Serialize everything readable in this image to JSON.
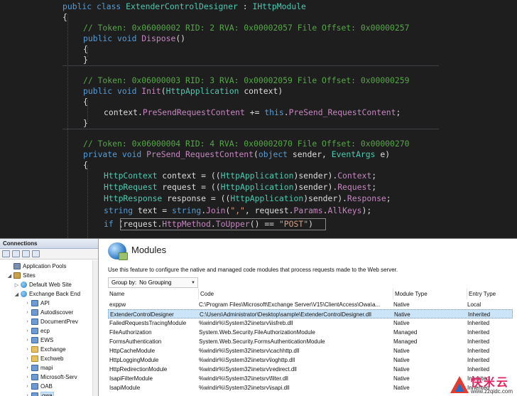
{
  "editor": {
    "class_decl": {
      "kw": "public class",
      "name": "ExtenderControlDesigner",
      "colon": ":",
      "iface": "IHttpModule"
    },
    "brace_open": "{",
    "brace_close": "}",
    "m1": {
      "comment": "// Token: 0x06000002 RID: 2 RVA: 0x00002057 File Offset: 0x00000257",
      "kw": "public void",
      "name": "Dispose",
      "args": "()"
    },
    "m2": {
      "comment": "// Token: 0x06000003 RID: 3 RVA: 0x00002059 File Offset: 0x00000259",
      "kw": "public void",
      "name": "Init",
      "args_open": "(",
      "ptype": "HttpApplication",
      "pname": " context)",
      "body": {
        "obj": "context",
        "dot": ".",
        "evt": "PreSendRequestContent",
        "op": " += ",
        "this": "this",
        "dot2": ".",
        "handler": "PreSend_RequestContent",
        "end": ";"
      }
    },
    "m3": {
      "comment": "// Token: 0x06000004 RID: 4 RVA: 0x00002070 File Offset: 0x00000270",
      "kw": "private void",
      "name": "PreSend_RequestContent",
      "open": "(",
      "t1": "object",
      "p1": " sender, ",
      "t2": "EventArgs",
      "p2": " e)",
      "l1": {
        "t": "HttpContext",
        "a": " context = ((",
        "c": "HttpApplication",
        "b": ")sender).",
        "p": "Context",
        "e": ";"
      },
      "l2": {
        "t": "HttpRequest",
        "a": " request = ((",
        "c": "HttpApplication",
        "b": ")sender).",
        "p": "Request",
        "e": ";"
      },
      "l3": {
        "t": "HttpResponse",
        "a": " response = ((",
        "c": "HttpApplication",
        "b": ")sender).",
        "p": "Response",
        "e": ";"
      },
      "l4": {
        "t": "string",
        "a": " text = ",
        "k": "string",
        "dot": ".",
        "f": "Join",
        "o": "(",
        "s": "\",\"",
        "b": ", request.",
        "p1": "Params",
        "dot2": ".",
        "p2": "AllKeys",
        "e": ");"
      },
      "l5": {
        "k": "if",
        "a": " (request.",
        "p1": "HttpMethod",
        "dot": ".",
        "f": "ToUpper",
        "b": "() == ",
        "s": "\"POST\"",
        "e": ")"
      }
    }
  },
  "connections": {
    "header": "Connections",
    "tree": [
      {
        "label": "Application Pools",
        "icon": "app-pool-icon"
      },
      {
        "label": "Sites",
        "icon": "sites-icon"
      },
      {
        "label": "Default Web Site",
        "icon": "globe-icon"
      },
      {
        "label": "Exchange Back End",
        "icon": "globe-icon"
      },
      {
        "label": "API",
        "icon": "folder-icon"
      },
      {
        "label": "Autodiscover",
        "icon": "folder-icon"
      },
      {
        "label": "DocumentPrev",
        "icon": "folder-icon"
      },
      {
        "label": "ecp",
        "icon": "folder-icon"
      },
      {
        "label": "EWS",
        "icon": "folder-icon"
      },
      {
        "label": "Exchange",
        "icon": "folder-icon"
      },
      {
        "label": "Exchweb",
        "icon": "folder-icon"
      },
      {
        "label": "mapi",
        "icon": "folder-icon"
      },
      {
        "label": "Microsoft-Serv",
        "icon": "folder-icon"
      },
      {
        "label": "OAB",
        "icon": "folder-icon"
      },
      {
        "label": "owa",
        "icon": "folder-icon"
      }
    ]
  },
  "modules": {
    "title": "Modules",
    "description": "Use this feature to configure the native and managed code modules that process requests made to the Web server.",
    "group_by_label": "Group by:",
    "group_by_value": "No Grouping",
    "columns": [
      "Name",
      "Code",
      "Module Type",
      "Entry Type"
    ],
    "rows": [
      [
        "exppw",
        "C:\\Program Files\\Microsoft\\Exchange Server\\V15\\ClientAccess\\Owa\\a...",
        "Native",
        "Local"
      ],
      [
        "ExtenderControlDesigner",
        "C:\\Users\\Administrator\\Desktop\\sample\\ExtenderControlDesigner.dll",
        "Native",
        "Inherited"
      ],
      [
        "FailedRequestsTracingModule",
        "%windir%\\System32\\inetsrv\\iisfreb.dll",
        "Native",
        "Inherited"
      ],
      [
        "FileAuthorization",
        "System.Web.Security.FileAuthorizationModule",
        "Managed",
        "Inherited"
      ],
      [
        "FormsAuthentication",
        "System.Web.Security.FormsAuthenticationModule",
        "Managed",
        "Inherited"
      ],
      [
        "HttpCacheModule",
        "%windir%\\System32\\inetsrv\\cachhttp.dll",
        "Native",
        "Inherited"
      ],
      [
        "HttpLoggingModule",
        "%windir%\\System32\\inetsrv\\loghttp.dll",
        "Native",
        "Inherited"
      ],
      [
        "HttpRedirectionModule",
        "%windir%\\System32\\inetsrv\\redirect.dll",
        "Native",
        "Inherited"
      ],
      [
        "IsapiFilterModule",
        "%windir%\\System32\\inetsrv\\filter.dll",
        "Native",
        "Inherited"
      ],
      [
        "IsapiModule",
        "%windir%\\System32\\inetsrv\\isapi.dll",
        "Native",
        "Inherited"
      ]
    ]
  },
  "watermark": {
    "brand": "快米云",
    "url": "www.zzqidc.com"
  }
}
